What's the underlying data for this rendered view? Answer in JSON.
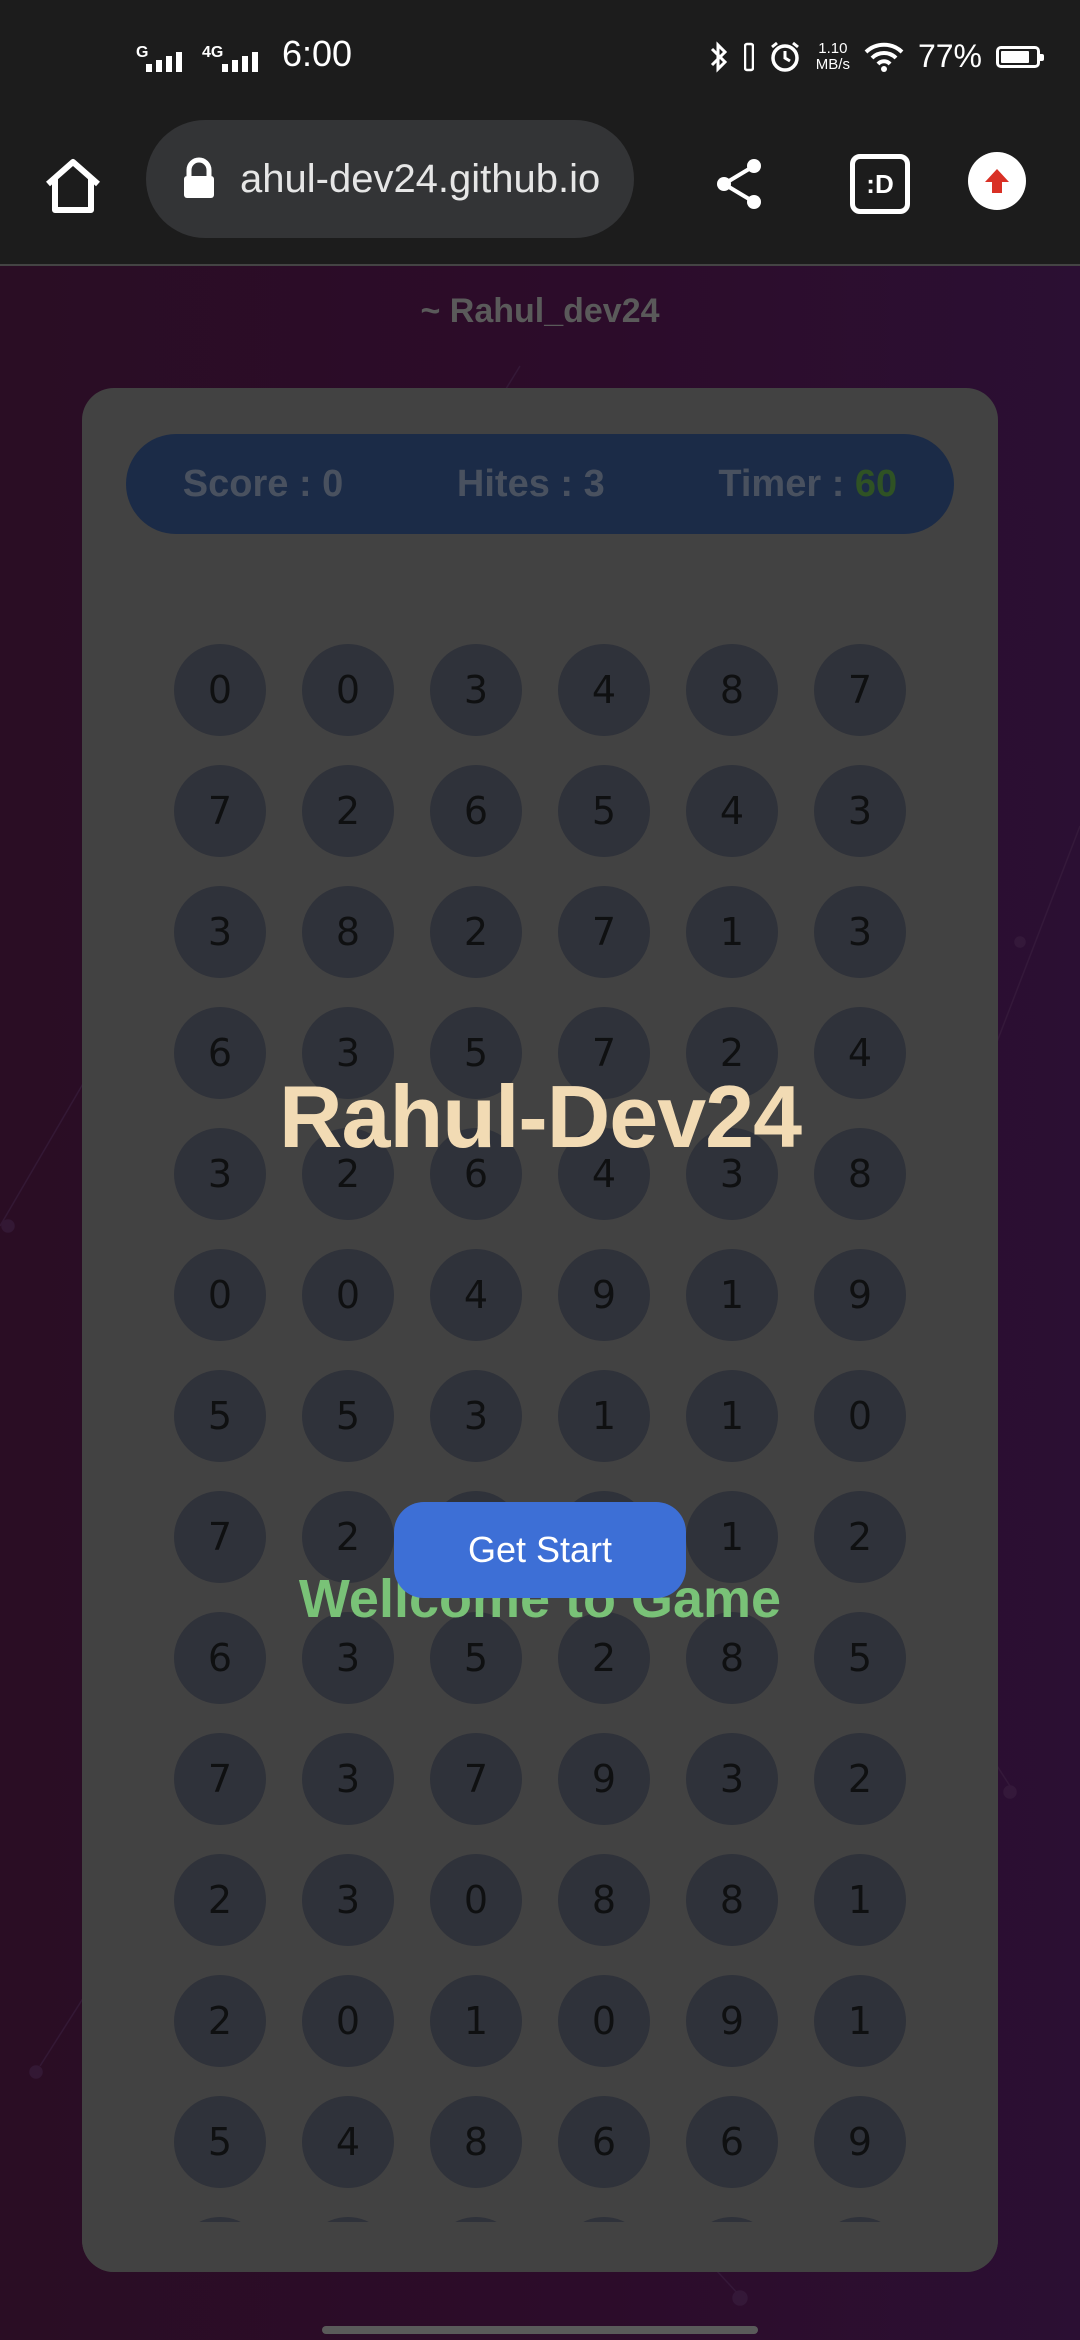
{
  "status_bar": {
    "network1": "G",
    "network2": "4G",
    "time": "6:00",
    "speed_value": "1.10",
    "speed_unit": "MB/s",
    "battery": "77%",
    "battery_level": 0.77
  },
  "browser": {
    "url": "ahul-dev24.github.io",
    "tabs_label": ":D",
    "icons": [
      "home-icon",
      "lock-icon",
      "share-icon",
      "tabs-icon",
      "update-icon"
    ]
  },
  "page": {
    "credit": "~ Rahul_dev24",
    "score": "Score : 0",
    "hits": "Hites : 3",
    "timer_label": "Timer : ",
    "timer_value": "60",
    "grid": [
      [
        "0",
        "0",
        "3",
        "4",
        "8",
        "7"
      ],
      [
        "7",
        "2",
        "6",
        "5",
        "4",
        "3"
      ],
      [
        "3",
        "8",
        "2",
        "7",
        "1",
        "3"
      ],
      [
        "6",
        "3",
        "5",
        "7",
        "2",
        "4"
      ],
      [
        "3",
        "2",
        "6",
        "4",
        "3",
        "8"
      ],
      [
        "0",
        "0",
        "4",
        "9",
        "1",
        "9"
      ],
      [
        "5",
        "5",
        "3",
        "1",
        "1",
        "0"
      ],
      [
        "7",
        "2",
        "",
        "",
        "1",
        "2"
      ],
      [
        "6",
        "3",
        "5",
        "2",
        "8",
        "5"
      ],
      [
        "7",
        "3",
        "7",
        "9",
        "3",
        "2"
      ],
      [
        "2",
        "3",
        "0",
        "8",
        "8",
        "1"
      ],
      [
        "2",
        "0",
        "1",
        "0",
        "9",
        "1"
      ],
      [
        "5",
        "4",
        "8",
        "6",
        "6",
        "9"
      ],
      [
        "",
        "",
        "",
        "",
        "",
        ""
      ]
    ],
    "overlay_title": "Rahul-Dev24",
    "overlay_subtitle": "Wellcome to Game",
    "start_button": "Get Start"
  },
  "colors": {
    "background": "#2b0d28",
    "card": "#424242",
    "score_bar": "#1b2b47",
    "title": "#f2dbb4",
    "subtitle": "#79c277",
    "button": "#3d6fd6"
  }
}
